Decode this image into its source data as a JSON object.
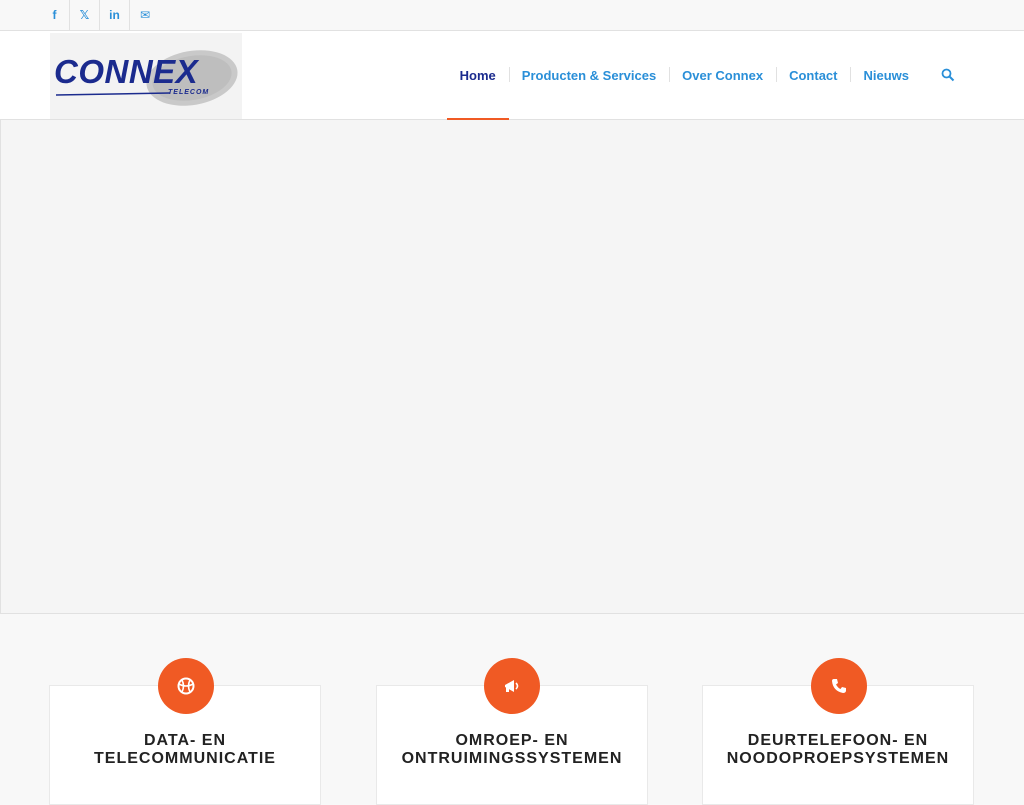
{
  "social": {
    "items": [
      {
        "icon": "facebook-icon",
        "glyph": "f"
      },
      {
        "icon": "x-twitter-icon",
        "glyph": "𝕏"
      },
      {
        "icon": "linkedin-icon",
        "glyph": "in"
      },
      {
        "icon": "mail-icon",
        "glyph": "✉"
      }
    ]
  },
  "logo": {
    "name": "CONNEX",
    "sub": "TELECOM"
  },
  "nav": {
    "home": "Home",
    "products": "Producten & Services",
    "about": "Over Connex",
    "contact": "Contact",
    "news": "Nieuws"
  },
  "services": [
    {
      "title": "DATA- EN TELECOMMUNICATIE",
      "icon": "globe-icon"
    },
    {
      "title": "OMROEP- EN ONTRUIMINGSSYSTEMEN",
      "icon": "megaphone-icon"
    },
    {
      "title": "DEURTELEFOON- EN NOODOPROEPSYSTEMEN",
      "icon": "phone-icon"
    }
  ],
  "colors": {
    "accent": "#f05a24",
    "link": "#2a8fd8",
    "brand": "#1b2b8e"
  }
}
